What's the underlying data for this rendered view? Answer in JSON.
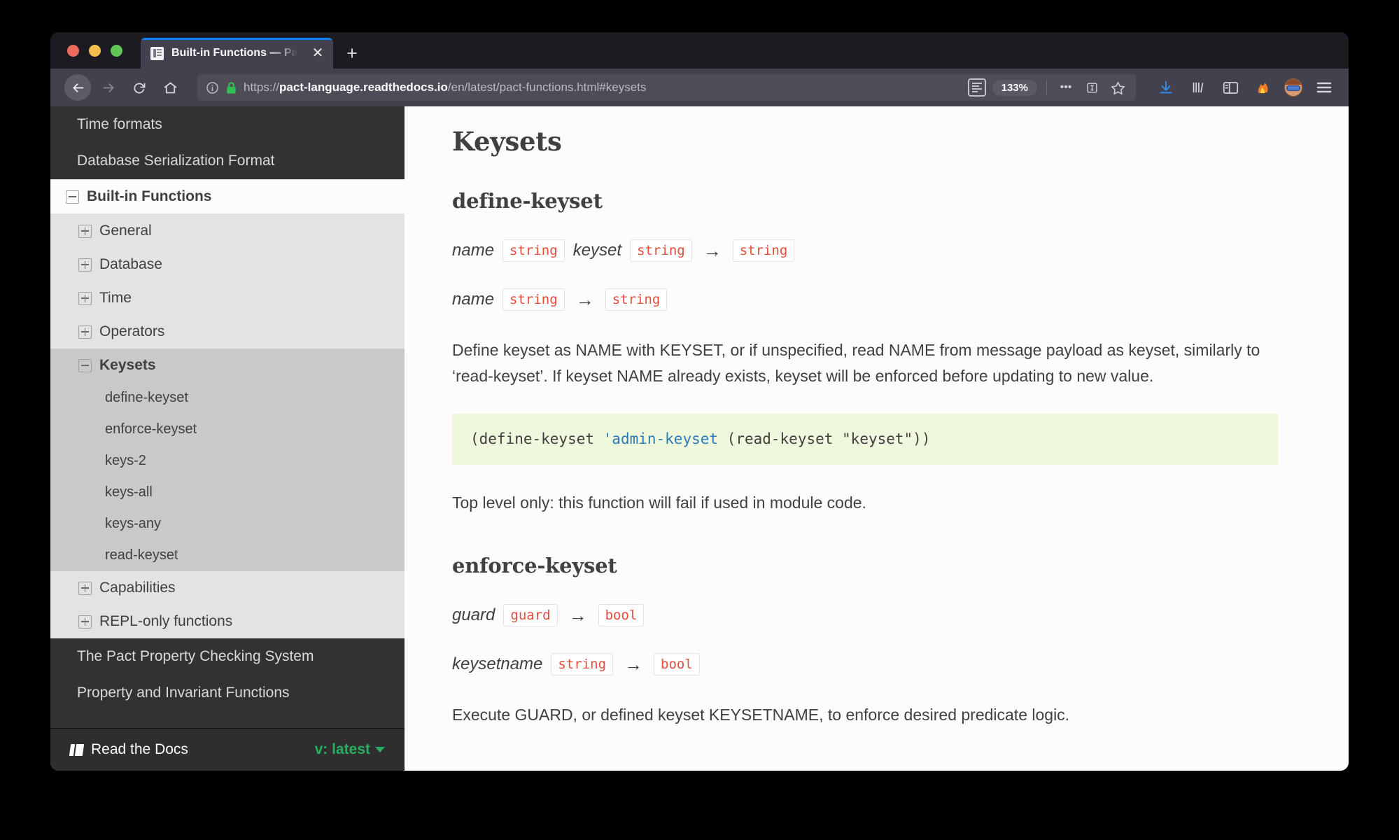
{
  "browser": {
    "tab": {
      "title": "Built-in Functions — Pact Langu",
      "favicon_name": "document-favicon",
      "close_label": "✕"
    },
    "new_tab_label": "+",
    "nav": {
      "back_label": "Back",
      "forward_label": "Forward",
      "reload_label": "Reload",
      "home_label": "Home"
    },
    "url": {
      "scheme": "https://",
      "host": "pact-language.readthedocs.io",
      "path": "/en/latest/pact-functions.html#keysets",
      "full": "https://pact-language.readthedocs.io/en/latest/pact-functions.html#keysets"
    },
    "zoom_level": "133%",
    "toolbar": {
      "reader_label": "Reader View",
      "page_actions_label": "•••",
      "pocket_label": "Save to Pocket",
      "bookmark_label": "Bookmark",
      "downloads_label": "Downloads",
      "library_label": "Library",
      "sidebar_label": "Sidebars",
      "extension_label": "Extension",
      "account_label": "Account",
      "menu_label": "Open menu"
    },
    "colors": {
      "accent": "#0a84ff",
      "chrome_bg": "#42414d",
      "tabstrip_bg": "#1c1b22"
    }
  },
  "sidebar": {
    "top_items": [
      {
        "label": "Time formats"
      },
      {
        "label": "Database Serialization Format"
      }
    ],
    "current_section": {
      "label": "Built-in Functions",
      "toggle": "minus"
    },
    "groups": [
      {
        "label": "General",
        "toggle": "plus",
        "current": false,
        "children": []
      },
      {
        "label": "Database",
        "toggle": "plus",
        "current": false,
        "children": []
      },
      {
        "label": "Time",
        "toggle": "plus",
        "current": false,
        "children": []
      },
      {
        "label": "Operators",
        "toggle": "plus",
        "current": false,
        "children": []
      },
      {
        "label": "Keysets",
        "toggle": "minus",
        "current": true,
        "children": [
          {
            "label": "define-keyset"
          },
          {
            "label": "enforce-keyset"
          },
          {
            "label": "keys-2"
          },
          {
            "label": "keys-all"
          },
          {
            "label": "keys-any"
          },
          {
            "label": "read-keyset"
          }
        ]
      },
      {
        "label": "Capabilities",
        "toggle": "plus",
        "current": false,
        "children": []
      },
      {
        "label": "REPL-only functions",
        "toggle": "plus",
        "current": false,
        "children": []
      }
    ],
    "bottom_items": [
      {
        "label": "The Pact Property Checking System"
      },
      {
        "label": "Property and Invariant Functions"
      }
    ],
    "footer": {
      "brand": "Read the Docs",
      "version_label": "v: latest",
      "version_color": "#27ae60"
    }
  },
  "content": {
    "page_title": "Keysets",
    "sections": [
      {
        "heading": "define-keyset",
        "signatures": [
          {
            "params": [
              {
                "name": "name",
                "type": "string"
              },
              {
                "name": "keyset",
                "type": "string"
              }
            ],
            "arrow": "→",
            "returns": "string"
          },
          {
            "params": [
              {
                "name": "name",
                "type": "string"
              }
            ],
            "arrow": "→",
            "returns": "string"
          }
        ],
        "paragraph": "Define keyset as NAME with KEYSET, or if unspecified, read NAME from message payload as keyset, similarly to ‘read-keyset’. If keyset NAME already exists, keyset will be enforced before updating to new value.",
        "code": {
          "before": "(define-keyset ",
          "symbol": "'admin-keyset",
          "after": " (read-keyset \"keyset\"))",
          "full": "(define-keyset 'admin-keyset (read-keyset \"keyset\"))"
        },
        "note": "Top level only: this function will fail if used in module code."
      },
      {
        "heading": "enforce-keyset",
        "signatures": [
          {
            "params": [
              {
                "name": "guard",
                "type": "guard"
              }
            ],
            "arrow": "→",
            "returns": "bool"
          },
          {
            "params": [
              {
                "name": "keysetname",
                "type": "string"
              }
            ],
            "arrow": "→",
            "returns": "bool"
          }
        ],
        "paragraph": "Execute GUARD, or defined keyset KEYSETNAME, to enforce desired predicate logic."
      }
    ],
    "colors": {
      "type_literal": "#e74c3c",
      "code_bg": "#eff8dd",
      "symbol": "#2b7bb9",
      "text": "#404040"
    }
  }
}
